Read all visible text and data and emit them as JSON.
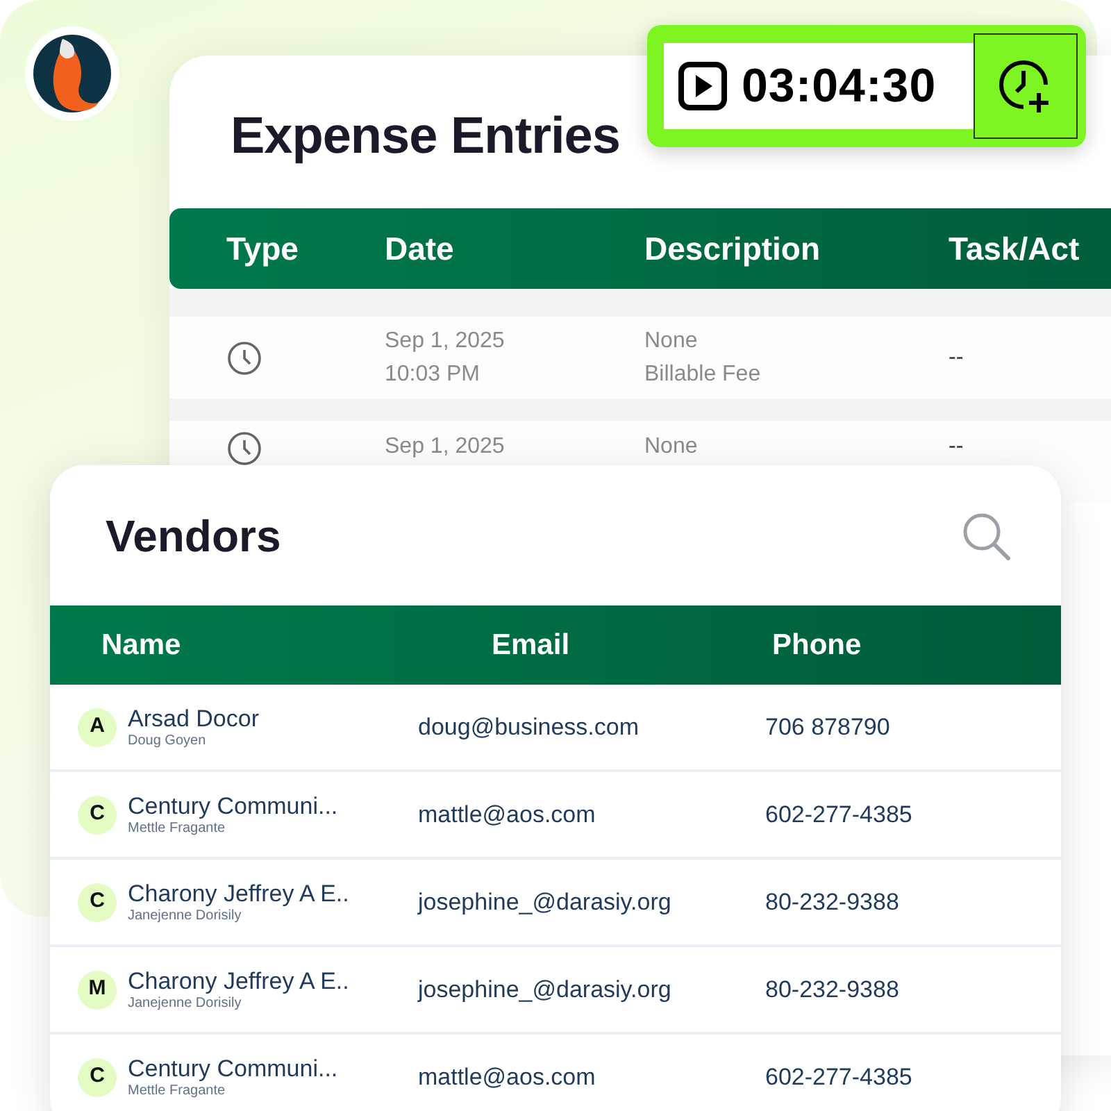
{
  "timer": {
    "time": "03:04:30"
  },
  "expense_entries": {
    "title": "Expense Entries",
    "columns": [
      "Type",
      "Date",
      "Description",
      "Task/Act"
    ],
    "rows": [
      {
        "kind": "time",
        "date": "Sep 1, 2025",
        "time": "10:03 PM",
        "description": "None",
        "detail": "Billable Fee",
        "task": "--"
      },
      {
        "kind": "time",
        "date": "Sep 1, 2025",
        "description": "None",
        "task": "--"
      }
    ]
  },
  "vendors": {
    "title": "Vendors",
    "columns": [
      "Name",
      "Email",
      "Phone"
    ],
    "rows": [
      {
        "initial": "A",
        "name": "Arsad Docor",
        "contact": "Doug Goyen",
        "email": "doug@business.com",
        "phone": "706 878790"
      },
      {
        "initial": "C",
        "name": "Century Communi...",
        "contact": "Mettle Fragante",
        "email": "mattle@aos.com",
        "phone": "602-277-4385"
      },
      {
        "initial": "C",
        "name": "Charony Jeffrey A E..",
        "contact": "Janejenne Dorisily",
        "email": "josephine_@darasiy.org",
        "phone": "80-232-9388"
      },
      {
        "initial": "M",
        "name": "Charony Jeffrey A E..",
        "contact": "Janejenne Dorisily",
        "email": "josephine_@darasiy.org",
        "phone": "80-232-9388"
      },
      {
        "initial": "C",
        "name": "Century Communi...",
        "contact": "Mettle Fragante",
        "email": "mattle@aos.com",
        "phone": "602-277-4385"
      }
    ]
  }
}
